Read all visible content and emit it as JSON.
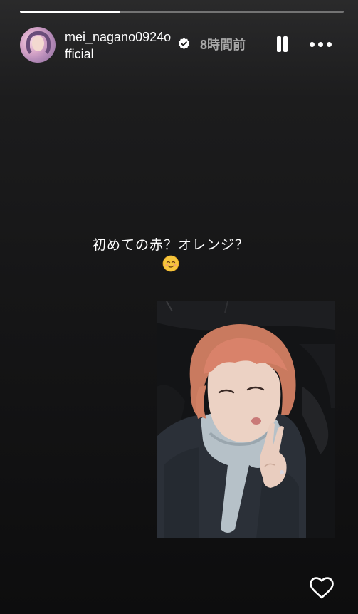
{
  "story": {
    "progress": 0.31,
    "account": {
      "username": "mei_nagano0924official",
      "verified": true,
      "avatar_description": "profile photo"
    },
    "time_ago": "8時間前",
    "controls": {
      "pause_icon": "pause-icon",
      "more_icon": "more-horizontal-icon"
    },
    "caption": {
      "text": "初めての赤？オレンジ？",
      "emoji_icon": "smiling-face-icon"
    },
    "photo": {
      "icon": "selfie-photo"
    },
    "like_icon": "heart-outline-icon"
  },
  "colors": {
    "background_top": "#2a2a2b",
    "background_bottom": "#0d0d0e",
    "text_primary": "#ffffff",
    "text_secondary": "#a8a8a8",
    "hair_color": "#d9826a"
  }
}
